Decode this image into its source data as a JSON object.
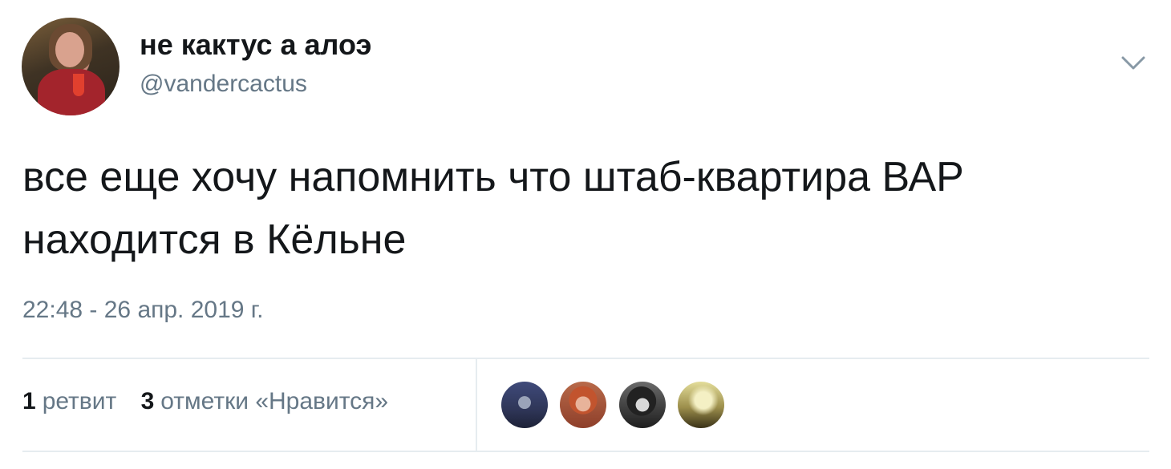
{
  "author": {
    "display_name": "не кактус а алоэ",
    "username": "@vandercactus"
  },
  "tweet": {
    "text": "все еще хочу напомнить что штаб-квартира ВАР находится в Кёльне",
    "timestamp": "22:48 - 26 апр. 2019 г."
  },
  "stats": {
    "retweets": {
      "count": "1",
      "label": "ретвит"
    },
    "likes": {
      "count": "3",
      "label": "отметки «Нравится»"
    }
  },
  "icons": {
    "menu": "chevron-down-icon"
  },
  "colors": {
    "text_primary": "#14171a",
    "text_secondary": "#657786",
    "divider": "#e6ecf0"
  }
}
